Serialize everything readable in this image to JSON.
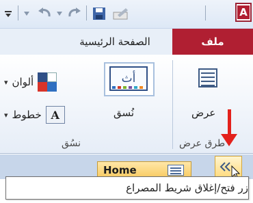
{
  "quick_access": {
    "items": [
      "dropdown-arrow-icon",
      "undo-icon",
      "redo-icon",
      "save-icon",
      "edit-icon"
    ],
    "app_letter": "A"
  },
  "tabs": {
    "file": "ملف",
    "home": "الصفحة الرئيسية"
  },
  "ribbon": {
    "views_group": {
      "button_label": "عرض",
      "group_label": "طرق عرض"
    },
    "themes_group": {
      "format_label": "نُسق",
      "format_glyph": "أث",
      "colors_label": "ألوان",
      "fonts_label": "خطوط",
      "fonts_glyph": "A",
      "group_label": "نسُق"
    }
  },
  "nav_pane": {
    "tab_label": "Home"
  },
  "tooltip": {
    "text": "زر فتح/إغلاق شريط المصراع"
  },
  "colors": {
    "file_tab": "#b01f32",
    "arrow": "#e3211c",
    "highlight": "#f7c85c"
  }
}
